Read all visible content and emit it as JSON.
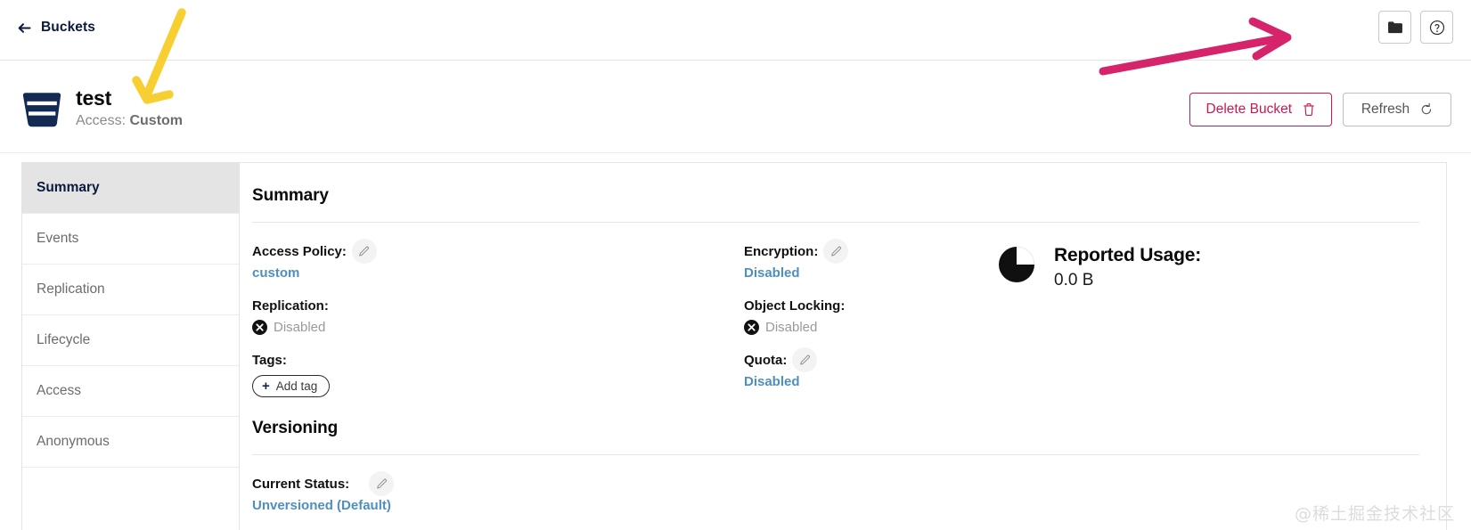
{
  "topbar": {
    "back_label": "Buckets",
    "back_icon": "arrow-left-icon",
    "actions": [
      {
        "name": "folder-browse-button",
        "icon": "folder-icon"
      },
      {
        "name": "help-button",
        "icon": "question-circle-icon"
      }
    ]
  },
  "bucket": {
    "icon": "bucket-icon",
    "name": "test",
    "access_prefix": "Access: ",
    "access_value": "Custom",
    "delete_label": "Delete Bucket",
    "delete_icon": "trash-icon",
    "refresh_label": "Refresh",
    "refresh_icon": "refresh-icon"
  },
  "sidebar": {
    "items": [
      {
        "label": "Summary",
        "active": true
      },
      {
        "label": "Events",
        "active": false
      },
      {
        "label": "Replication",
        "active": false
      },
      {
        "label": "Lifecycle",
        "active": false
      },
      {
        "label": "Access",
        "active": false
      },
      {
        "label": "Anonymous",
        "active": false
      }
    ]
  },
  "summary": {
    "heading": "Summary",
    "access_policy": {
      "label": "Access Policy:",
      "value": "custom",
      "edit_icon": "pencil-icon"
    },
    "replication": {
      "label": "Replication:",
      "value": "Disabled",
      "status_icon": "x-circle-icon"
    },
    "tags": {
      "label": "Tags:",
      "add_label": "Add tag",
      "add_icon": "plus-icon"
    },
    "encryption": {
      "label": "Encryption:",
      "value": "Disabled",
      "edit_icon": "pencil-icon"
    },
    "object_locking": {
      "label": "Object Locking:",
      "value": "Disabled",
      "status_icon": "x-circle-icon"
    },
    "quota": {
      "label": "Quota:",
      "value": "Disabled",
      "edit_icon": "pencil-icon"
    },
    "usage": {
      "title": "Reported Usage:",
      "value": "0.0 B",
      "chart_icon": "pie-chart-icon"
    }
  },
  "versioning": {
    "heading": "Versioning",
    "current_status": {
      "label": "Current Status:",
      "value": "Unversioned (Default)",
      "edit_icon": "pencil-icon"
    }
  },
  "annotations": {
    "yellow_arrow_color": "#f7cf32",
    "pink_arrow_color": "#d6246a",
    "watermark": "@稀土掘金技术社区"
  },
  "colors": {
    "brand_navy": "#0b1a3c",
    "danger": "#c51a52",
    "link_blue": "#4f8fc0",
    "sidebar_active_bg": "#e4e4e4"
  }
}
